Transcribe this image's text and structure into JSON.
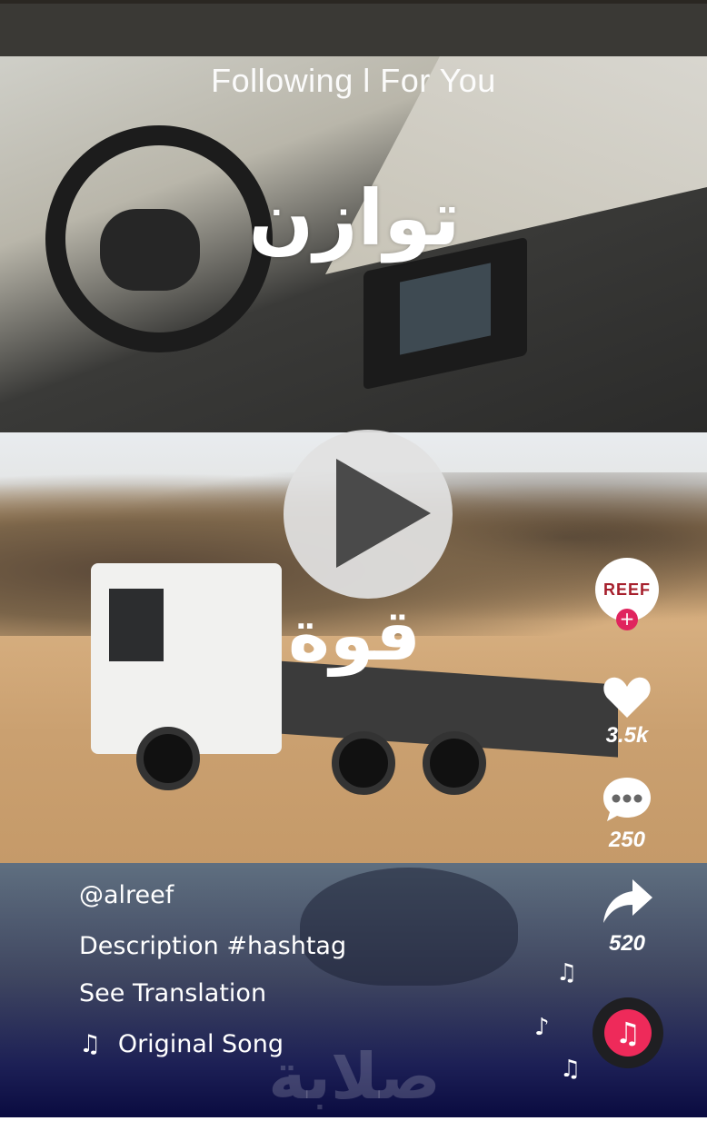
{
  "header": {
    "tabs_text": "Following l For You"
  },
  "video": {
    "overlay_text_top": "توازن",
    "overlay_text_middle": "قوة",
    "overlay_text_bottom": "صلابة"
  },
  "creator": {
    "avatar_logo": "REEF"
  },
  "actions": {
    "likes": "3.5k",
    "comments": "250",
    "shares": "520"
  },
  "caption": {
    "username": "@alreef",
    "description": "Description #hashtag",
    "see_translation": "See Translation",
    "music_note_icon": "♫",
    "song": "Original Song"
  },
  "icons": {
    "play": "play-icon",
    "heart": "heart-icon",
    "comment": "comment-icon",
    "share": "share-icon",
    "music_disc": "music-disc-icon"
  },
  "colors": {
    "accent": "#ee2a5a",
    "follow_badge": "#e0245e"
  }
}
